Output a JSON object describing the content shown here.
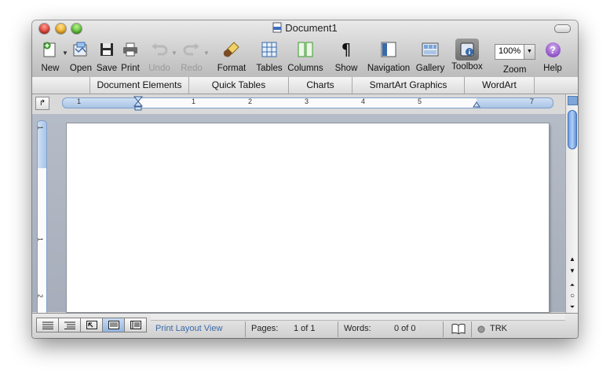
{
  "window": {
    "title": "Document1"
  },
  "toolbar": {
    "new": "New",
    "open": "Open",
    "save": "Save",
    "print": "Print",
    "undo": "Undo",
    "redo": "Redo",
    "format": "Format",
    "tables": "Tables",
    "columns": "Columns",
    "show": "Show",
    "navigation": "Navigation",
    "gallery": "Gallery",
    "toolbox": "Toolbox",
    "zoom": "Zoom",
    "help": "Help",
    "zoom_value": "100%"
  },
  "ribbon": {
    "tabs": [
      "Document Elements",
      "Quick Tables",
      "Charts",
      "SmartArt Graphics",
      "WordArt"
    ]
  },
  "ruler": {
    "h_marks": [
      "1",
      "1",
      "2",
      "3",
      "4",
      "5",
      "7"
    ],
    "v_marks": [
      "1",
      "1",
      "2"
    ]
  },
  "status": {
    "view_name": "Print Layout View",
    "pages_label": "Pages:",
    "pages_value": "1 of 1",
    "words_label": "Words:",
    "words_value": "0 of 0",
    "track": "TRK"
  },
  "colors": {
    "accent": "#3a6aa8",
    "ruler": "#a9c4e6",
    "page_bg": "#b5bcc7"
  }
}
